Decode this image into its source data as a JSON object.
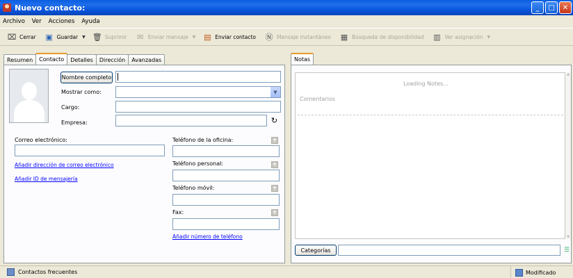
{
  "window": {
    "title": "Nuevo contacto:"
  },
  "menu": [
    "Archivo",
    "Ver",
    "Acciones",
    "Ayuda"
  ],
  "toolbar": {
    "cerrar": "Cerrar",
    "guardar": "Guardar",
    "suprimir": "Suprimir",
    "enviar_mensaje": "Enviar mensaje",
    "enviar_contacto": "Enviar contacto",
    "mensaje_instantaneo": "Mensaje instantáneo",
    "busqueda": "Búsqueda de disponibilidad",
    "ver_asignacion": "Ver asignación"
  },
  "tabs": [
    "Resumen",
    "Contacto",
    "Detalles",
    "Dirección",
    "Avanzadas"
  ],
  "contact": {
    "nombre_completo_button": "Nombre completo",
    "mostrar_como": "Mostrar como:",
    "cargo": "Cargo:",
    "empresa": "Empresa:",
    "correo": "Correo electrónico:",
    "add_email": "Añadir dirección de correo electrónico",
    "add_im": "Añadir ID de mensajería",
    "tel_oficina": "Teléfono de la oficina:",
    "tel_personal": "Teléfono personal:",
    "tel_movil": "Teléfono móvil:",
    "fax": "Fax:",
    "add_phone": "Añadir número de teléfono"
  },
  "notes": {
    "tab": "Notas",
    "loading": "Loading Notes...",
    "comentarios": "Comentarios",
    "categorias_button": "Categorías"
  },
  "status": {
    "left": "Contactos frecuentes",
    "right": "Modificado"
  },
  "colors": {
    "title_bar": "#0A5FE0",
    "link": "#0000FF",
    "active_tab_accent": "#E89A2C"
  }
}
